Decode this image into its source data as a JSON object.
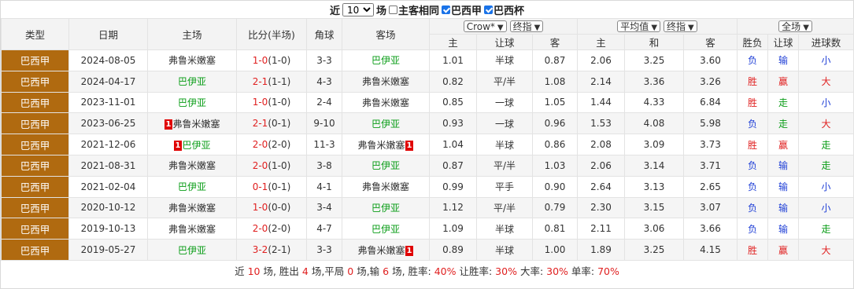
{
  "filter": {
    "prefix": "近",
    "count_value": "10",
    "suffix": "场",
    "same_home_label": "主客相同",
    "league1_label": "巴西甲",
    "league2_label": "巴西杯"
  },
  "header": {
    "type": "类型",
    "date": "日期",
    "home": "主场",
    "score": "比分(半场)",
    "corner": "角球",
    "away": "客场",
    "company_select": "Crow*",
    "odds_select": "终指",
    "avg_select": "平均值",
    "avg_odds_select": "终指",
    "range_select": "全场",
    "sub_home": "主",
    "sub_handicap": "让球",
    "sub_away": "客",
    "sub_home2": "主",
    "sub_draw": "和",
    "sub_away2": "客",
    "sub_wl": "胜负",
    "sub_ah": "让球",
    "sub_ou": "进球数"
  },
  "rows": [
    {
      "type": "巴西甲",
      "date": "2024-08-05",
      "home": "弗鲁米嫩塞",
      "home_color": "dark",
      "home_badge": "",
      "score": "1-0",
      "half": "(1-0)",
      "corner": "3-3",
      "away": "巴伊亚",
      "away_color": "green",
      "away_badge": "",
      "o1": "1.01",
      "hcp": "半球",
      "o2": "0.87",
      "e1": "2.06",
      "e2": "3.25",
      "e3": "3.60",
      "wl": "负",
      "ah": "输",
      "ou": "小"
    },
    {
      "type": "巴西甲",
      "date": "2024-04-17",
      "home": "巴伊亚",
      "home_color": "green",
      "home_badge": "",
      "score": "2-1",
      "half": "(1-1)",
      "corner": "4-3",
      "away": "弗鲁米嫩塞",
      "away_color": "dark",
      "away_badge": "",
      "o1": "0.82",
      "hcp": "平/半",
      "o2": "1.08",
      "e1": "2.14",
      "e2": "3.36",
      "e3": "3.26",
      "wl": "胜",
      "ah": "赢",
      "ou": "大"
    },
    {
      "type": "巴西甲",
      "date": "2023-11-01",
      "home": "巴伊亚",
      "home_color": "green",
      "home_badge": "",
      "score": "1-0",
      "half": "(1-0)",
      "corner": "2-4",
      "away": "弗鲁米嫩塞",
      "away_color": "dark",
      "away_badge": "",
      "o1": "0.85",
      "hcp": "一球",
      "o2": "1.05",
      "e1": "1.44",
      "e2": "4.33",
      "e3": "6.84",
      "wl": "胜",
      "ah": "走",
      "ou": "小"
    },
    {
      "type": "巴西甲",
      "date": "2023-06-25",
      "home": "弗鲁米嫩塞",
      "home_color": "dark",
      "home_badge": "1",
      "score": "2-1",
      "half": "(0-1)",
      "corner": "9-10",
      "away": "巴伊亚",
      "away_color": "green",
      "away_badge": "",
      "o1": "0.93",
      "hcp": "一球",
      "o2": "0.96",
      "e1": "1.53",
      "e2": "4.08",
      "e3": "5.98",
      "wl": "负",
      "ah": "走",
      "ou": "大"
    },
    {
      "type": "巴西甲",
      "date": "2021-12-06",
      "home": "巴伊亚",
      "home_color": "green",
      "home_badge": "1",
      "score": "2-0",
      "half": "(2-0)",
      "corner": "11-3",
      "away": "弗鲁米嫩塞",
      "away_color": "dark",
      "away_badge": "1",
      "o1": "1.04",
      "hcp": "半球",
      "o2": "0.86",
      "e1": "2.08",
      "e2": "3.09",
      "e3": "3.73",
      "wl": "胜",
      "ah": "赢",
      "ou": "走"
    },
    {
      "type": "巴西甲",
      "date": "2021-08-31",
      "home": "弗鲁米嫩塞",
      "home_color": "dark",
      "home_badge": "",
      "score": "2-0",
      "half": "(1-0)",
      "corner": "3-8",
      "away": "巴伊亚",
      "away_color": "green",
      "away_badge": "",
      "o1": "0.87",
      "hcp": "平/半",
      "o2": "1.03",
      "e1": "2.06",
      "e2": "3.14",
      "e3": "3.71",
      "wl": "负",
      "ah": "输",
      "ou": "走"
    },
    {
      "type": "巴西甲",
      "date": "2021-02-04",
      "home": "巴伊亚",
      "home_color": "green",
      "home_badge": "",
      "score": "0-1",
      "half": "(0-1)",
      "corner": "4-1",
      "away": "弗鲁米嫩塞",
      "away_color": "dark",
      "away_badge": "",
      "o1": "0.99",
      "hcp": "平手",
      "o2": "0.90",
      "e1": "2.64",
      "e2": "3.13",
      "e3": "2.65",
      "wl": "负",
      "ah": "输",
      "ou": "小"
    },
    {
      "type": "巴西甲",
      "date": "2020-10-12",
      "home": "弗鲁米嫩塞",
      "home_color": "dark",
      "home_badge": "",
      "score": "1-0",
      "half": "(0-0)",
      "corner": "3-4",
      "away": "巴伊亚",
      "away_color": "green",
      "away_badge": "",
      "o1": "1.12",
      "hcp": "平/半",
      "o2": "0.79",
      "e1": "2.30",
      "e2": "3.15",
      "e3": "3.07",
      "wl": "负",
      "ah": "输",
      "ou": "小"
    },
    {
      "type": "巴西甲",
      "date": "2019-10-13",
      "home": "弗鲁米嫩塞",
      "home_color": "dark",
      "home_badge": "",
      "score": "2-0",
      "half": "(2-0)",
      "corner": "4-7",
      "away": "巴伊亚",
      "away_color": "green",
      "away_badge": "",
      "o1": "1.09",
      "hcp": "半球",
      "o2": "0.81",
      "e1": "2.11",
      "e2": "3.06",
      "e3": "3.66",
      "wl": "负",
      "ah": "输",
      "ou": "走"
    },
    {
      "type": "巴西甲",
      "date": "2019-05-27",
      "home": "巴伊亚",
      "home_color": "green",
      "home_badge": "",
      "score": "3-2",
      "half": "(2-1)",
      "corner": "3-3",
      "away": "弗鲁米嫩塞",
      "away_color": "dark",
      "away_badge": "1",
      "o1": "0.89",
      "hcp": "半球",
      "o2": "1.00",
      "e1": "1.89",
      "e2": "3.25",
      "e3": "4.15",
      "wl": "胜",
      "ah": "赢",
      "ou": "大"
    }
  ],
  "summary": {
    "t1": "近 ",
    "n_games": "10",
    "t2": " 场, 胜出 ",
    "wins": "4",
    "t3": " 场,平局 ",
    "draws": "0",
    "t4": " 场,输 ",
    "losses": "6",
    "t5": " 场, 胜率: ",
    "win_rate": "40%",
    "t6": " 让胜率: ",
    "ah_rate": "30%",
    "t7": " 大率: ",
    "over_rate": "30%",
    "t8": " 单率: ",
    "odd_rate": "70%"
  },
  "colors": {
    "type_bg": "#b06a10",
    "green": "#0a9d17",
    "red": "#e02020",
    "blue": "#1f3fd6",
    "badge": "#e00000"
  }
}
